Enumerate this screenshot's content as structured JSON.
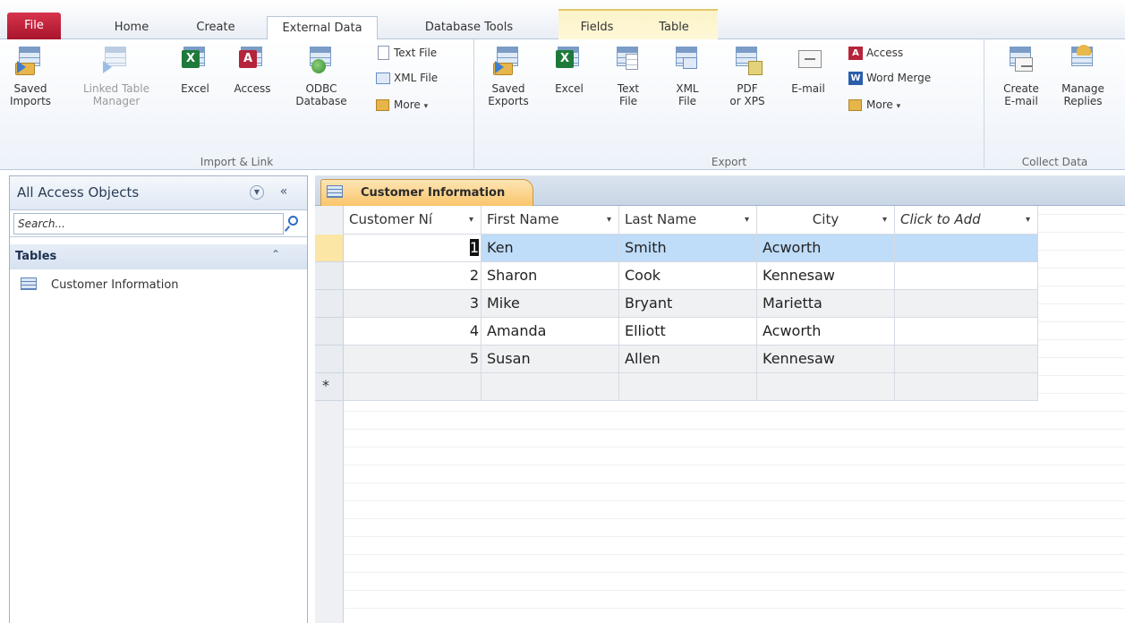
{
  "tabs": [
    "File",
    "Home",
    "Create",
    "External Data",
    "Database Tools",
    "Fields",
    "Table"
  ],
  "active_tab": "External Data",
  "ribbon": {
    "import_link": {
      "label": "Import & Link",
      "saved_imports": "Saved\nImports",
      "linked_table_manager": "Linked Table\nManager",
      "excel": "Excel",
      "access": "Access",
      "odbc": "ODBC\nDatabase",
      "text_file": "Text File",
      "xml_file": "XML File",
      "more": "More"
    },
    "export": {
      "label": "Export",
      "saved_exports": "Saved\nExports",
      "excel": "Excel",
      "text_file": "Text\nFile",
      "xml_file": "XML\nFile",
      "pdf_xps": "PDF\nor XPS",
      "email": "E-mail",
      "access": "Access",
      "word_merge": "Word Merge",
      "more": "More"
    },
    "collect": {
      "label": "Collect Data",
      "create_email": "Create\nE-mail",
      "manage_replies": "Manage\nReplies"
    }
  },
  "nav": {
    "title": "All Access Objects",
    "search_placeholder": "Search...",
    "section": "Tables",
    "items": [
      "Customer Information"
    ]
  },
  "document": {
    "tab_label": "Customer Information",
    "columns": [
      "Customer Ní",
      "First Name",
      "Last Name",
      "City",
      "Click to Add"
    ],
    "rows": [
      {
        "id": "1",
        "first": "Ken",
        "last": "Smith",
        "city": "Acworth"
      },
      {
        "id": "2",
        "first": "Sharon",
        "last": "Cook",
        "city": "Kennesaw"
      },
      {
        "id": "3",
        "first": "Mike",
        "last": "Bryant",
        "city": "Marietta"
      },
      {
        "id": "4",
        "first": "Amanda",
        "last": "Elliott",
        "city": "Acworth"
      },
      {
        "id": "5",
        "first": "Susan",
        "last": "Allen",
        "city": "Kennesaw"
      }
    ],
    "new_row_symbol": "*"
  },
  "colors": {
    "file_tab": "#b5243a",
    "selected_row": "#bfdcf8",
    "doc_tab": "#f9c56b"
  }
}
